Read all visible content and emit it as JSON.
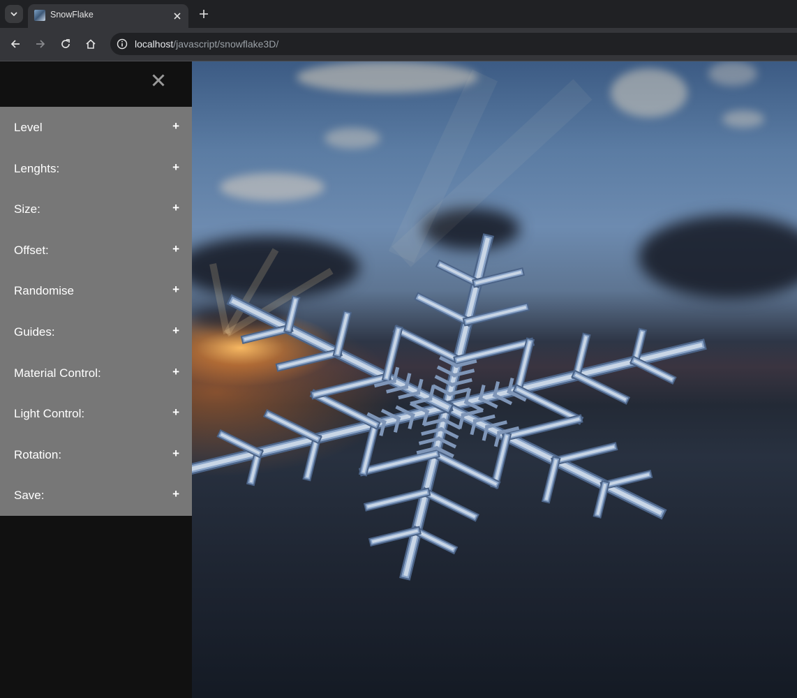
{
  "browser": {
    "tab_title": "SnowFlake",
    "url_host": "localhost",
    "url_path": "/javascript/snowflake3D/"
  },
  "sidebar": {
    "menu": [
      {
        "label": "Level",
        "icon": "+"
      },
      {
        "label": "Lenghts:",
        "icon": "+"
      },
      {
        "label": "Size:",
        "icon": "+"
      },
      {
        "label": "Offset:",
        "icon": "+"
      },
      {
        "label": "Randomise",
        "icon": "+"
      },
      {
        "label": "Guides:",
        "icon": "+"
      },
      {
        "label": "Material Control:",
        "icon": "+"
      },
      {
        "label": "Light Control:",
        "icon": "+"
      },
      {
        "label": "Rotation:",
        "icon": "+"
      },
      {
        "label": "Save:",
        "icon": "+"
      }
    ]
  },
  "colors": {
    "sidebar_bg": "#111111",
    "menu_bg": "#777777",
    "menu_text": "#ffffff"
  }
}
